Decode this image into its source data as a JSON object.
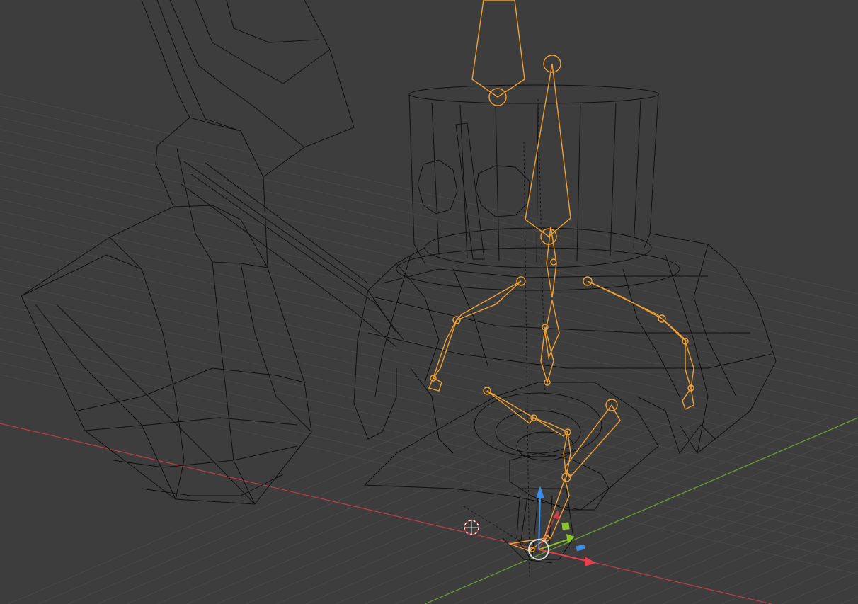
{
  "viewport": {
    "view": "3d-viewport",
    "shading_mode": "wireframe",
    "colors": {
      "background": "#3d3d3d",
      "grid": "#484848",
      "wire": "#101010",
      "armature_selected": "#f0a030",
      "x_axis": "#b43c48",
      "y_axis": "#6b9a32",
      "gizmo_x": "#e8404e",
      "gizmo_y": "#8bc32e",
      "gizmo_z": "#3a8ee6",
      "cursor": "#ffffff"
    }
  },
  "scene": {
    "objects": [
      {
        "name": "hammer",
        "icon": "mesh-icon"
      },
      {
        "name": "top-hat-character",
        "icon": "mesh-icon"
      },
      {
        "name": "armature",
        "icon": "armature-icon",
        "selected": true
      }
    ]
  },
  "gizmo": {
    "type": "move-transform",
    "axes": [
      "x",
      "y",
      "z"
    ]
  },
  "cursor": {
    "type": "3d-cursor"
  }
}
